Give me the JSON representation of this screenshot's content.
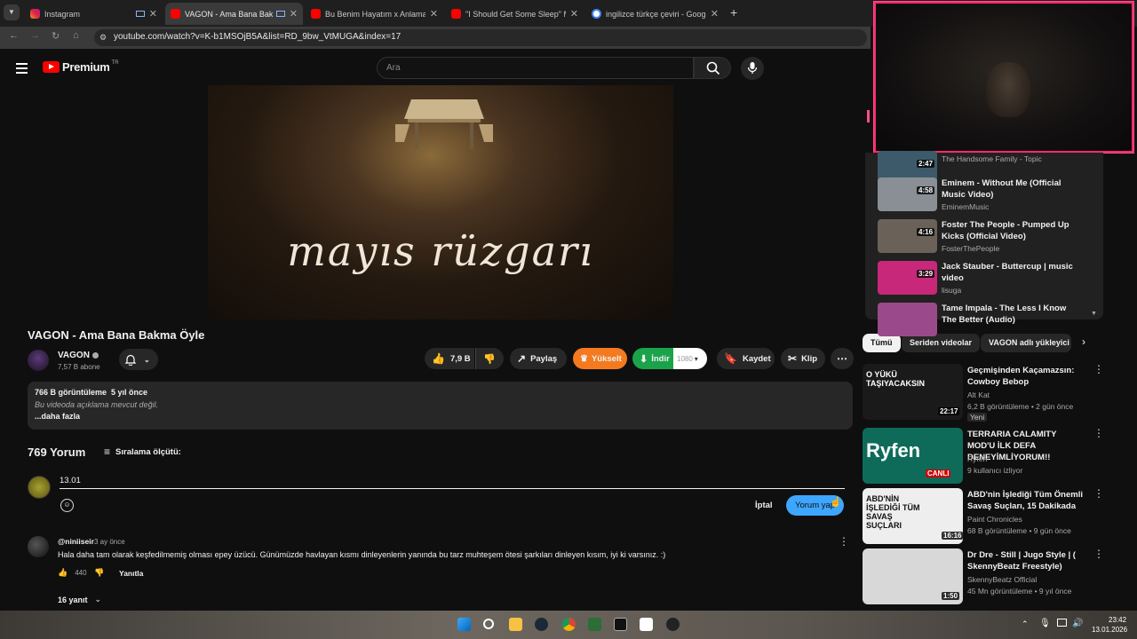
{
  "browser": {
    "tabs": [
      {
        "label": "Instagram",
        "color": "#d6249f"
      },
      {
        "label": "VAGON - Ama Bana Bakma",
        "color": "#ff0000"
      },
      {
        "label": "Bu Benim Hayatım x Anlamazdı",
        "color": "#ff0000"
      },
      {
        "label": "\"I Should Get Some Sleep\" Me",
        "color": "#ff0000"
      },
      {
        "label": "ingilizce türkçe çeviri - Google",
        "color": "#4285f4"
      }
    ],
    "url": "youtube.com/watch?v=K-b1MSOjB5A&list=RD_9bw_VtMUGA&index=17"
  },
  "header": {
    "brand": "Premium",
    "region": "TR",
    "search_placeholder": "Ara"
  },
  "video": {
    "overlay_text": "mayıs rüzgarı",
    "title": "VAGON - Ama Bana Bakma Öyle",
    "channel": "VAGON",
    "subscribers": "7,57 B abone",
    "likes": "7,9 B",
    "share_label": "Paylaş",
    "upgrade_label": "Yükselt",
    "download_label": "İndir",
    "quality": "1080",
    "save_label": "Kaydet",
    "clip_label": "Klip"
  },
  "description": {
    "stats": "766 B görüntüleme  5 yıl önce",
    "text": "Bu videoda açıklama mevcut değil.",
    "more": "...daha fazla"
  },
  "comments": {
    "count_label": "769 Yorum",
    "sort_label": "Sıralama ölçütü:",
    "draft": "13.01",
    "cancel": "İptal",
    "submit": "Yorum yap",
    "items": [
      {
        "author": "@niniiseir",
        "time": "3 ay önce",
        "text": "Hala daha tam olarak keşfedilmemiş olması epey üzücü. Günümüzde havlayan kısmı dinleyenlerin yanında bu tarz muhteşem ötesi şarkıları dinleyen kısım, iyi ki varsınız. :)",
        "likes": "440",
        "reply": "Yanıtla",
        "replies": "16 yanıt"
      }
    ]
  },
  "playlist": [
    {
      "title": "",
      "artist": "The Handsome Family - Topic",
      "duration": "2:47",
      "color": "#3d5a6a"
    },
    {
      "title": "Eminem - Without Me (Official Music Video)",
      "artist": "EminemMusic",
      "duration": "4:58",
      "color": "#8a8f95"
    },
    {
      "title": "Foster The People - Pumped Up Kicks (Official Video)",
      "artist": "FosterThePeople",
      "duration": "4:16",
      "color": "#6a6258"
    },
    {
      "title": "Jack Stauber - Buttercup | music video",
      "artist": "lisuga",
      "duration": "3:29",
      "color": "#c8287a"
    },
    {
      "title": "Tame Impala - The Less I Know The Better (Audio)",
      "artist": "",
      "duration": "",
      "color": "#9a4a8a"
    }
  ],
  "chips": [
    "Tümü",
    "Seriden videolar",
    "VAGON adlı yükleyici"
  ],
  "recommendations": [
    {
      "title": "Geçmişinden Kaçamazsın: Cowboy Bebop",
      "channel": "Alt Kat",
      "meta": "6,2 B görüntüleme • 2 gün önce",
      "badge": "Yeni",
      "duration": "22:17",
      "thumb_text": "O YÜKÜ TAŞIYACAKSIN",
      "color": "#1a1a1a"
    },
    {
      "title": "TERRARIA CALAMITY MOD'U İLK DEFA DENEYİMLİYORUM!!",
      "channel": "Ryfen",
      "meta": "9 kullanıcı izliyor",
      "badge": "CANLI",
      "duration": "",
      "thumb_text": "Ryfen",
      "color": "#0e6b5a"
    },
    {
      "title": "ABD'nin İşlediği Tüm Önemli Savaş Suçları, 15 Dakikada",
      "channel": "Paint Chronicles",
      "meta": "68 B görüntüleme • 9 gün önce",
      "badge": "",
      "duration": "16:16",
      "thumb_text": "ABD'NİN İŞLEDİĞİ TÜM SAVAŞ SUÇLARI",
      "color": "#eeeeee"
    },
    {
      "title": "Dr Dre - Still | Jugo Style | ( SkennyBeatz Freestyle)",
      "channel": "SkennyBeatz Official",
      "meta": "45 Mn görüntüleme • 9 yıl önce",
      "badge": "",
      "duration": "1:50",
      "thumb_text": "",
      "color": "#d8d8d8"
    }
  ],
  "taskbar": {
    "time": "23:42",
    "date": "13.01.2026"
  }
}
